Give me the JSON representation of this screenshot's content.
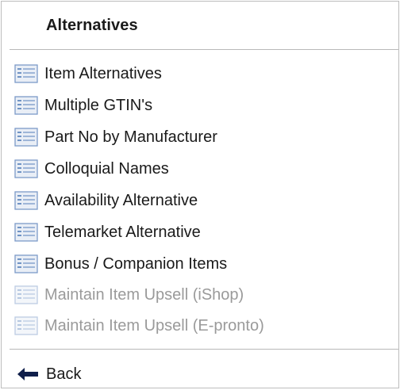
{
  "menu": {
    "title": "Alternatives",
    "items": [
      {
        "label": "Item Alternatives",
        "enabled": true,
        "icon": "list-icon"
      },
      {
        "label": "Multiple GTIN's",
        "enabled": true,
        "icon": "list-icon"
      },
      {
        "label": "Part No by Manufacturer",
        "enabled": true,
        "icon": "list-icon"
      },
      {
        "label": "Colloquial Names",
        "enabled": true,
        "icon": "list-icon"
      },
      {
        "label": "Availability Alternative",
        "enabled": true,
        "icon": "list-icon"
      },
      {
        "label": "Telemarket Alternative",
        "enabled": true,
        "icon": "list-icon"
      },
      {
        "label": "Bonus / Companion Items",
        "enabled": true,
        "icon": "list-icon"
      },
      {
        "label": "Maintain Item Upsell (iShop)",
        "enabled": false,
        "icon": "list-icon"
      },
      {
        "label": "Maintain Item Upsell (E-pronto)",
        "enabled": false,
        "icon": "list-icon"
      }
    ]
  },
  "footer": {
    "back_label": "Back",
    "back_icon": "arrow-left-icon"
  },
  "colors": {
    "text": "#1a1a1a",
    "disabled_text": "#9a9a9a",
    "icon_blue": "#6f93c4",
    "divider": "#b8b8b8"
  }
}
